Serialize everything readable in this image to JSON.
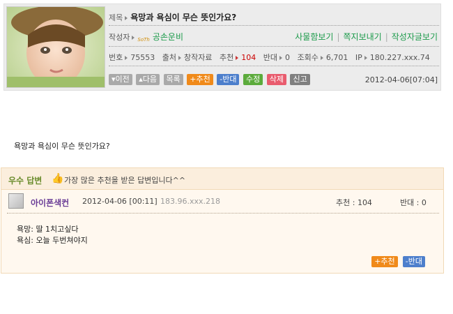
{
  "post": {
    "title_label": "제목",
    "title": "욕망과 욕심이 무슨 뜻인가요?",
    "writer_label": "작성자",
    "writer_level": "SoTh",
    "writer_name": "공손운비",
    "links": [
      "사물함보기",
      "쪽지보내기",
      "작성자글보기"
    ],
    "stats": {
      "no_label": "번호",
      "no": "75553",
      "source_label": "출처",
      "source": "창작자료",
      "recommend_label": "추천",
      "recommend": "104",
      "oppose_label": "반대",
      "oppose": "0",
      "views_label": "조회수",
      "views": "6,701",
      "ip_label": "IP",
      "ip": "180.227.xxx.74"
    },
    "buttons": {
      "prev": "▾이전",
      "next": "▴다음",
      "list": "목록",
      "recommend": "+추천",
      "oppose": "-반대",
      "edit": "수정",
      "delete": "삭제",
      "report": "신고"
    },
    "date": "2012-04-06[07:04]"
  },
  "question": "욕망과 욕심이 무슨 뜻인가요?",
  "answer": {
    "best_label": "우수 답변",
    "best_desc": "가장 많은 추천을 받은 답변입니다^^",
    "answerer": "아이폰색컨",
    "date": "2012-04-06 [00:11]",
    "ip": "183.96.xxx.218",
    "recommend_text": "추천 : 104",
    "oppose_text": "반대 : 0",
    "body_lines": [
      "욕망: 딸 1치고싶다",
      "욕심: 오늘 두번쳐야지"
    ],
    "recommend_btn": "+추천",
    "oppose_btn": "-반대"
  },
  "colors": {
    "accent_green": "#1b9a4a",
    "recommend_orange": "#f08a1a",
    "oppose_blue": "#4d7fcc"
  }
}
